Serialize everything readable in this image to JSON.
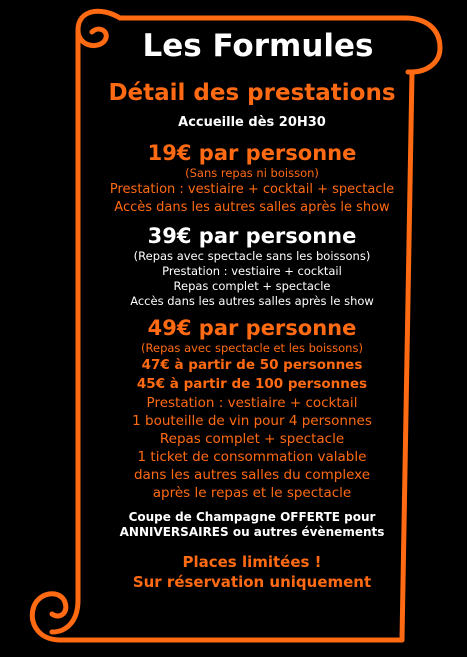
{
  "title": "Les Formules",
  "subtitle": "Détail des prestations",
  "intro": "Accueille dès 20H30",
  "formula1": {
    "price": "19€ par personne",
    "note": "(Sans repas ni boisson)",
    "lines": [
      "Prestation : vestiaire + cocktail + spectacle",
      "Accès dans les autres salles après le show"
    ]
  },
  "formula2": {
    "price": "39€ par personne",
    "note": "(Repas avec spectacle sans les boissons)",
    "lines": [
      "Prestation : vestiaire + cocktail",
      "Repas complet + spectacle",
      "Accès dans les autres salles après le show"
    ]
  },
  "formula3": {
    "price": "49€ par personne",
    "note": "(Repas avec spectacle et les boissons)",
    "lines": [
      "47€ à partir de 50 personnes",
      "45€ à partir de 100 personnes",
      "Prestation : vestiaire + cocktail",
      "1 bouteille de vin pour 4 personnes",
      "Repas complet + spectacle",
      "1 ticket de consommation valable",
      "dans les autres salles du complexe",
      "après le repas et le spectacle"
    ]
  },
  "offer": [
    "Coupe de Champagne OFFERTE pour",
    "ANNIVERSAIRES  ou autres évènements"
  ],
  "footer": [
    "Places limitées !",
    "Sur réservation uniquement"
  ],
  "colors": {
    "background": "#000000",
    "accent": "#ff6a13",
    "text": "#ffffff"
  }
}
